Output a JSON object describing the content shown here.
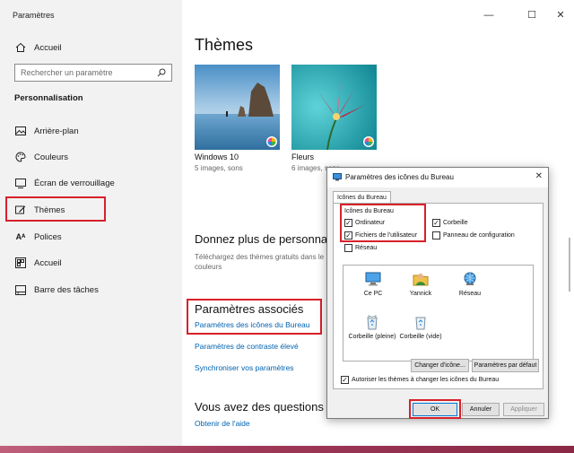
{
  "window": {
    "title": "Paramètres",
    "controls": {
      "minimize": "—",
      "maximize": "☐",
      "close": "✕"
    }
  },
  "sidebar": {
    "home": "Accueil",
    "search_placeholder": "Rechercher un paramètre",
    "section": "Personnalisation",
    "items": [
      {
        "label": "Arrière-plan",
        "icon": "image-icon"
      },
      {
        "label": "Couleurs",
        "icon": "palette-icon"
      },
      {
        "label": "Écran de verrouillage",
        "icon": "lockscreen-icon"
      },
      {
        "label": "Thèmes",
        "icon": "brush-icon"
      },
      {
        "label": "Polices",
        "icon": "font-icon"
      },
      {
        "label": "Accueil",
        "icon": "start-icon"
      },
      {
        "label": "Barre des tâches",
        "icon": "taskbar-icon"
      }
    ]
  },
  "main": {
    "title": "Thèmes",
    "themes": [
      {
        "name": "Windows 10",
        "sub": "5 images, sons"
      },
      {
        "name": "Fleurs",
        "sub": "6 images, sons"
      }
    ],
    "more_heading": "Donnez plus de personnalit",
    "more_text_1": "Téléchargez des thèmes gratuits dans le",
    "more_text_2": "couleurs",
    "related_heading": "Paramètres associés",
    "related_links": [
      "Paramètres des icônes du Bureau",
      "Paramètres de contraste élevé",
      "Synchroniser vos paramètres"
    ],
    "questions_heading": "Vous avez des questions ?",
    "help_link": "Obtenir de l'aide"
  },
  "dialog": {
    "title": "Paramètres des icônes du Bureau",
    "close": "✕",
    "tab": "Icônes du Bureau",
    "group_label": "Icônes du Bureau",
    "checkboxes": [
      {
        "label": "Ordinateur",
        "checked": true
      },
      {
        "label": "Corbeille",
        "checked": true
      },
      {
        "label": "Fichiers de l'utilisateur",
        "checked": true
      },
      {
        "label": "Panneau de configuration",
        "checked": false
      },
      {
        "label": "Réseau",
        "checked": false
      }
    ],
    "icons": [
      {
        "label": "Ce PC",
        "icon": "computer-icon"
      },
      {
        "label": "Yannick",
        "icon": "user-folder-icon"
      },
      {
        "label": "Réseau",
        "icon": "network-icon"
      },
      {
        "label": "Corbeille (pleine)",
        "icon": "recycle-bin-full-icon"
      },
      {
        "label": "Corbeille (vide)",
        "icon": "recycle-bin-empty-icon"
      }
    ],
    "change_icon_button": "Changer d'icône...",
    "default_button": "Paramètres par défaut",
    "allow_themes_label": "Autoriser les thèmes à changer les icônes du Bureau",
    "allow_themes_checked": true,
    "ok_button": "OK",
    "cancel_button": "Annuler",
    "apply_button": "Appliquer"
  },
  "colors": {
    "accent": "#0063b1",
    "highlight": "#d8202a"
  }
}
